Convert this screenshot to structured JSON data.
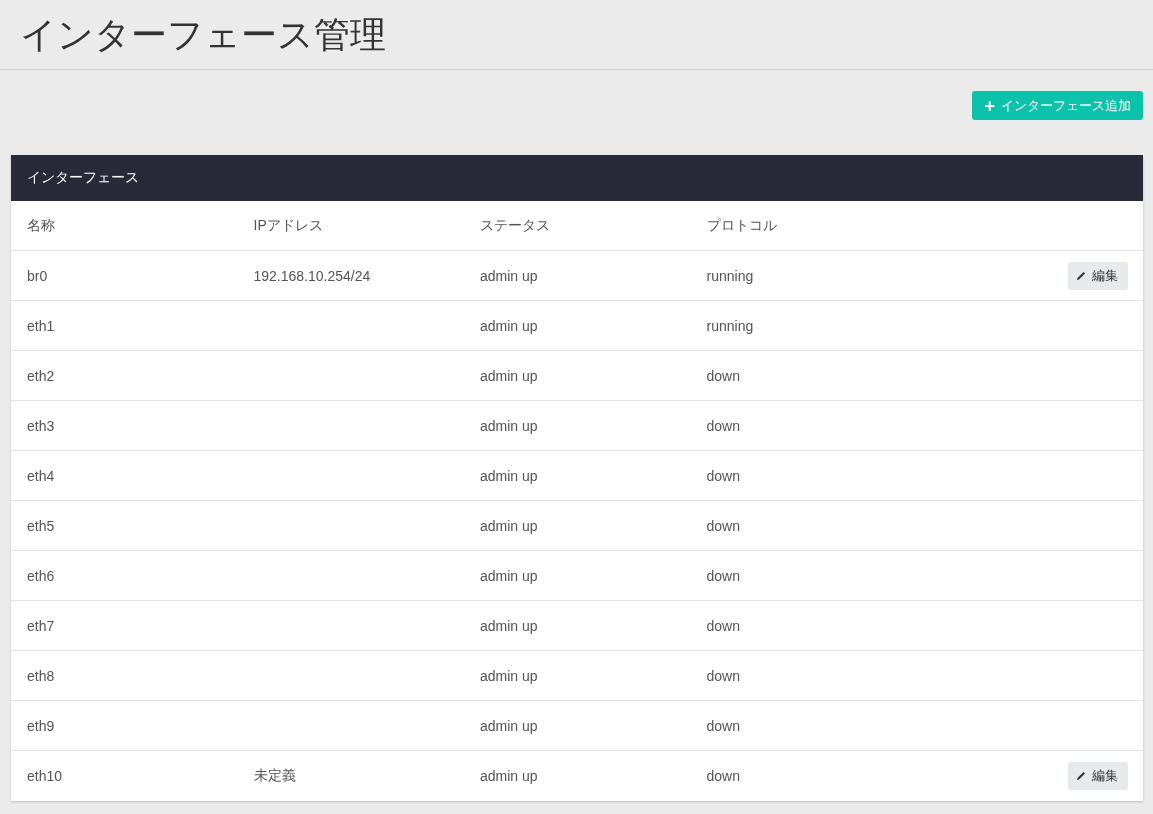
{
  "page": {
    "title": "インターフェース管理"
  },
  "add_button": {
    "icon": "+",
    "label": "インターフェース追加"
  },
  "panel": {
    "title": "インターフェース"
  },
  "table": {
    "columns": [
      "名称",
      "IPアドレス",
      "ステータス",
      "プロトコル"
    ],
    "rows": [
      {
        "cells": [
          "br0",
          "192.168.10.254/24",
          "admin up",
          "running"
        ],
        "edit_button": "編集"
      },
      {
        "cells": [
          "eth1",
          "",
          "admin up",
          "running"
        ]
      },
      {
        "cells": [
          "eth2",
          "",
          "admin up",
          "down"
        ]
      },
      {
        "cells": [
          "eth3",
          "",
          "admin up",
          "down"
        ]
      },
      {
        "cells": [
          "eth4",
          "",
          "admin up",
          "down"
        ]
      },
      {
        "cells": [
          "eth5",
          "",
          "admin up",
          "down"
        ]
      },
      {
        "cells": [
          "eth6",
          "",
          "admin up",
          "down"
        ]
      },
      {
        "cells": [
          "eth7",
          "",
          "admin up",
          "down"
        ]
      },
      {
        "cells": [
          "eth8",
          "",
          "admin up",
          "down"
        ]
      },
      {
        "cells": [
          "eth9",
          "",
          "admin up",
          "down"
        ]
      },
      {
        "cells": [
          "eth10",
          "未定義",
          "admin up",
          "down"
        ],
        "edit_button": "編集"
      }
    ]
  }
}
